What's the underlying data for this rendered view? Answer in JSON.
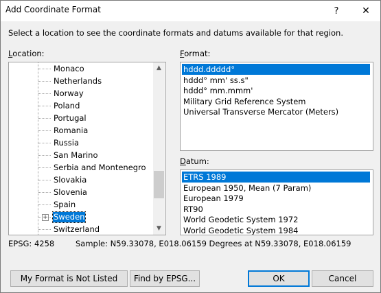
{
  "window": {
    "title": "Add Coordinate Format",
    "help_glyph": "?",
    "close_glyph": "✕"
  },
  "instruction": "Select a location to see the coordinate formats and datums available for that region.",
  "location": {
    "label_mnemonic": "L",
    "label_rest": "ocation:",
    "items": [
      "Monaco",
      "Netherlands",
      "Norway",
      "Poland",
      "Portugal",
      "Romania",
      "Russia",
      "San Marino",
      "Serbia and Montenegro",
      "Slovakia",
      "Slovenia",
      "Spain",
      "Sweden",
      "Switzerland"
    ],
    "selected": "Sweden",
    "expander_glyph": "+"
  },
  "format": {
    "label_mnemonic": "F",
    "label_rest": "ormat:",
    "items": [
      "hddd.ddddd°",
      "hddd° mm' ss.s\"",
      "hddd° mm.mmm'",
      "Military Grid Reference System",
      "Universal Transverse Mercator (Meters)"
    ],
    "selected": "hddd.ddddd°"
  },
  "datum": {
    "label_mnemonic": "D",
    "label_rest": "atum:",
    "items": [
      "ETRS 1989",
      "European 1950, Mean (7 Param)",
      "European 1979",
      "RT90",
      "World Geodetic System 1972",
      "World Geodetic System 1984"
    ],
    "selected": "ETRS 1989"
  },
  "status": {
    "epsg": "EPSG: 4258",
    "sample": "Sample: N59.33078, E018.06159 Degrees at N59.33078, E018.06159"
  },
  "buttons": {
    "not_listed": "My Format is Not Listed",
    "find_epsg": "Find by EPSG...",
    "ok": "OK",
    "cancel": "Cancel"
  },
  "colors": {
    "selection": "#0078d7",
    "dialog_bg": "#f0f0f0"
  }
}
